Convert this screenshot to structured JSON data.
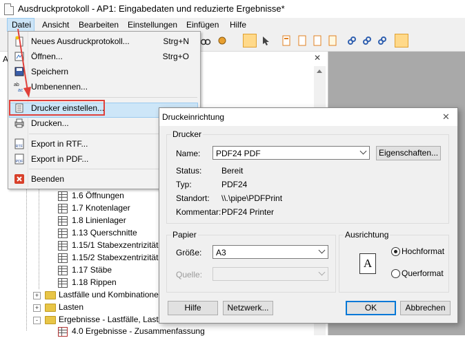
{
  "window": {
    "title": "Ausdruckprotokoll - AP1: Eingabedaten und reduzierte Ergebnisse*"
  },
  "menubar": {
    "items": [
      "Datei",
      "Ansicht",
      "Bearbeiten",
      "Einstellungen",
      "Einfügen",
      "Hilfe"
    ]
  },
  "file_menu": {
    "items": [
      {
        "label": "Neues Ausdruckprotokoll...",
        "shortcut": "Strg+N",
        "icon": "new-protocol-icon"
      },
      {
        "label": "Öffnen...",
        "shortcut": "Strg+O",
        "icon": "open-icon"
      },
      {
        "label": "Speichern",
        "shortcut": "",
        "icon": "save-icon"
      },
      {
        "label": "Umbenennen...",
        "shortcut": "",
        "icon": "rename-icon"
      },
      {
        "label": "Drucker einstellen...",
        "shortcut": "",
        "icon": "printer-setup-icon"
      },
      {
        "label": "Drucken...",
        "shortcut": "",
        "icon": "print-icon"
      },
      {
        "label": "Export in RTF...",
        "shortcut": "",
        "icon": "rtf-export-icon"
      },
      {
        "label": "Export in PDF...",
        "shortcut": "",
        "icon": "pdf-export-icon"
      },
      {
        "label": "Beenden",
        "shortcut": "",
        "icon": "exit-icon"
      }
    ],
    "highlighted": "Drucker einstellen..."
  },
  "nav_panel": {
    "header_partial": "A"
  },
  "tree": {
    "items": [
      {
        "label": "1.6 Öffnungen",
        "type": "table"
      },
      {
        "label": "1.7 Knotenlager",
        "type": "table"
      },
      {
        "label": "1.8 Linienlager",
        "type": "table"
      },
      {
        "label": "1.13 Querschnitte",
        "type": "table"
      },
      {
        "label": "1.15/1 Stabexzentrizitäte",
        "type": "table"
      },
      {
        "label": "1.15/2 Stabexzentrizitäte",
        "type": "table"
      },
      {
        "label": "1.17 Stäbe",
        "type": "table"
      },
      {
        "label": "1.18 Rippen",
        "type": "table"
      },
      {
        "label": "Lastfälle und Kombinatione",
        "type": "folder",
        "expander": "+"
      },
      {
        "label": "Lasten",
        "type": "folder",
        "expander": "+"
      },
      {
        "label": "Ergebnisse - Lastfälle, Lastkc",
        "type": "folder",
        "expander": "-"
      },
      {
        "label": "4.0 Ergebnisse - Zusammenfassung",
        "type": "result"
      }
    ]
  },
  "dialog": {
    "title": "Druckeinrichtung",
    "printer_group": {
      "label": "Drucker",
      "name_label": "Name:",
      "name_value": "PDF24 PDF",
      "properties_button": "Eigenschaften...",
      "status_label": "Status:",
      "status_value": "Bereit",
      "type_label": "Typ:",
      "type_value": "PDF24",
      "location_label": "Standort:",
      "location_value": "\\\\.\\pipe\\PDFPrint",
      "comment_label": "Kommentar:",
      "comment_value": "PDF24 Printer"
    },
    "paper_group": {
      "label": "Papier",
      "size_label": "Größe:",
      "size_value": "A3",
      "source_label": "Quelle:",
      "source_value": ""
    },
    "orientation_group": {
      "label": "Ausrichtung",
      "portrait_label": "Hochformat",
      "landscape_label": "Querformat",
      "selected": "Hochformat",
      "preview_letter": "A"
    },
    "buttons": {
      "help": "Hilfe",
      "network": "Netzwerk...",
      "ok": "OK",
      "cancel": "Abbrechen"
    }
  },
  "colors": {
    "highlight": "#cde6f8",
    "annotation_red": "#e0403a",
    "menu_bg": "#f2f2f2"
  }
}
